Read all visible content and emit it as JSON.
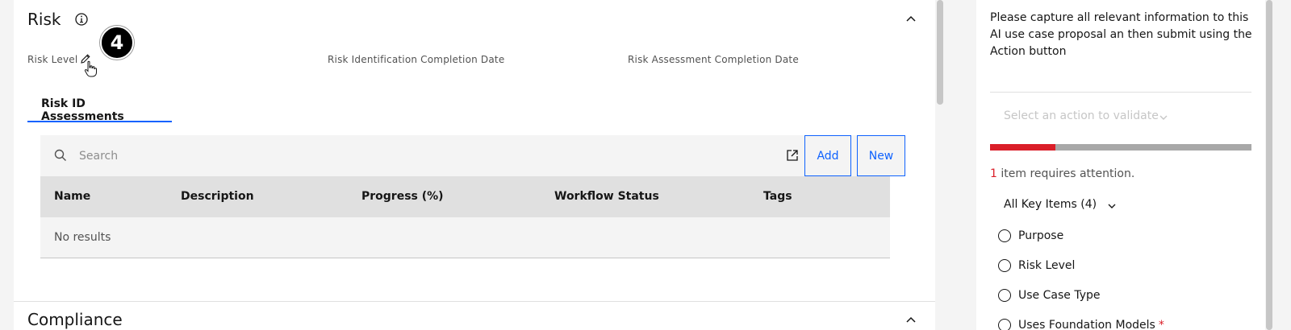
{
  "risk": {
    "title": "Risk",
    "fields": [
      "Risk Level",
      "Risk Identification Completion Date",
      "Risk Assessment Completion Date"
    ],
    "step_badge": "4",
    "tab_label": "Risk ID Assessments",
    "search_placeholder": "Search",
    "add_label": "Add",
    "new_label": "New",
    "columns": [
      "Name",
      "Description",
      "Progress (%)",
      "Workflow Status",
      "Tags"
    ],
    "empty_text": "No results"
  },
  "compliance": {
    "title": "Compliance"
  },
  "side": {
    "description": "Please capture all relevant information to this AI use case proposal an then submit using the Action button",
    "action_placeholder": "Select an action to validate",
    "progress_fraction": 0.25,
    "attention_count": "1",
    "attention_text": " item requires attention.",
    "key_items_label": "All Key Items (4)",
    "key_items": [
      {
        "label": "Purpose",
        "required": false
      },
      {
        "label": "Risk Level",
        "required": false
      },
      {
        "label": "Use Case Type",
        "required": false
      },
      {
        "label": "Uses Foundation Models",
        "required": true
      }
    ],
    "required_mark": "*"
  },
  "colors": {
    "accent": "#0f62fe",
    "error": "#da1e28",
    "surface": "#ffffff",
    "background": "#f4f4f4"
  },
  "icons": [
    "info-icon",
    "chevron-up-icon",
    "edit-icon",
    "pointer-hand-icon",
    "search-icon",
    "export-icon",
    "chevron-down-icon",
    "radio-icon"
  ]
}
